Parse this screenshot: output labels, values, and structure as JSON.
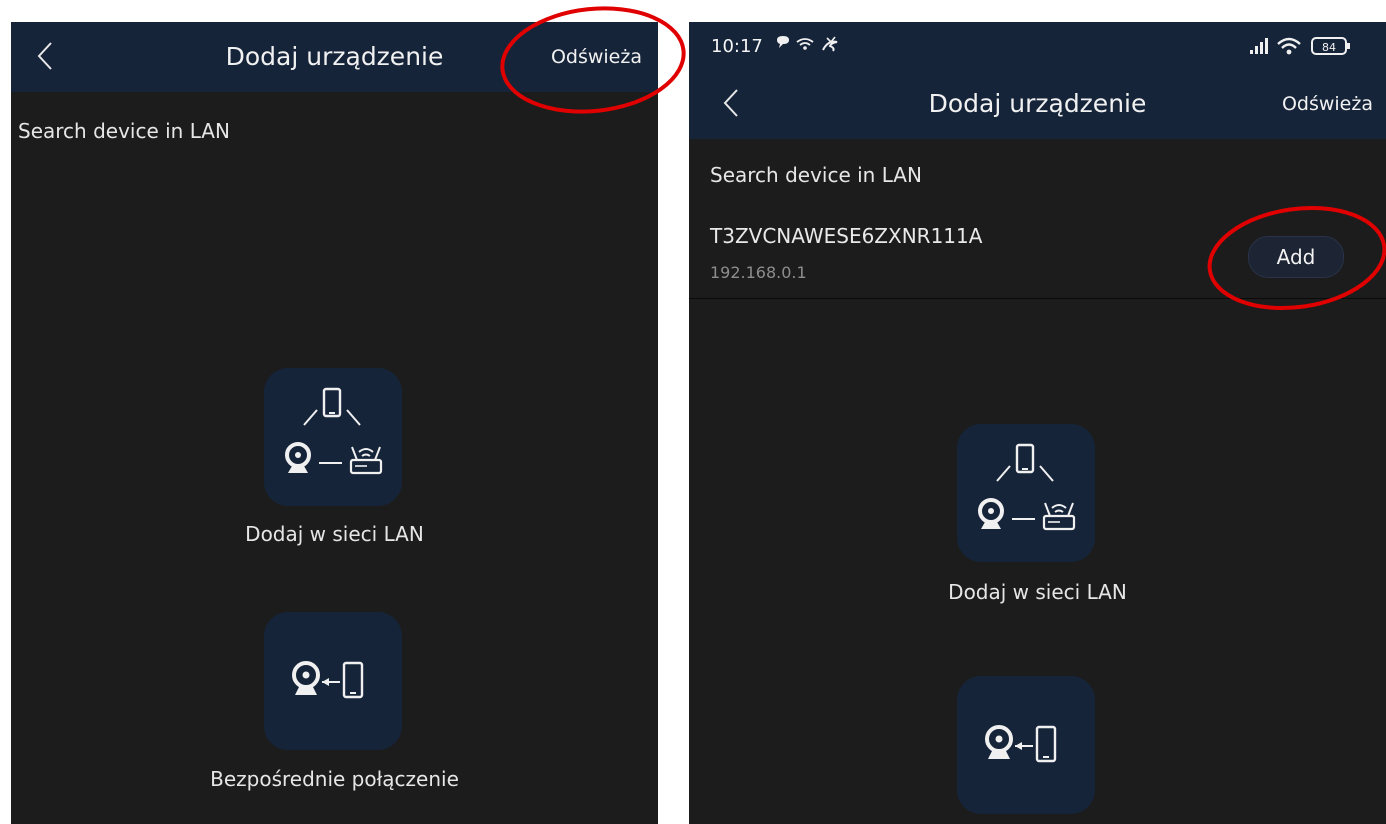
{
  "left_screen": {
    "header": {
      "title": "Dodaj urządzenie",
      "refresh_label": "Odświeża"
    },
    "section_label": "Search device in LAN",
    "options": [
      {
        "label": "Dodaj w sieci LAN",
        "icon": "lan-network-icon"
      },
      {
        "label": "Bezpośrednie połączenie",
        "icon": "direct-connection-icon"
      }
    ]
  },
  "right_screen": {
    "status_bar": {
      "time": "10:17",
      "battery": "84"
    },
    "header": {
      "title": "Dodaj urządzenie",
      "refresh_label": "Odświeża"
    },
    "section_label": "Search device in LAN",
    "device": {
      "id": "T3ZVCNAWESE6ZXNR111A",
      "ip": "192.168.0.1",
      "add_label": "Add"
    },
    "options": [
      {
        "label": "Dodaj w sieci LAN",
        "icon": "lan-network-icon"
      },
      {
        "label": "",
        "icon": "direct-connection-icon"
      }
    ]
  },
  "colors": {
    "header_bg": "#16243a",
    "screen_bg": "#1c1c1c",
    "annotation": "#e00000"
  }
}
